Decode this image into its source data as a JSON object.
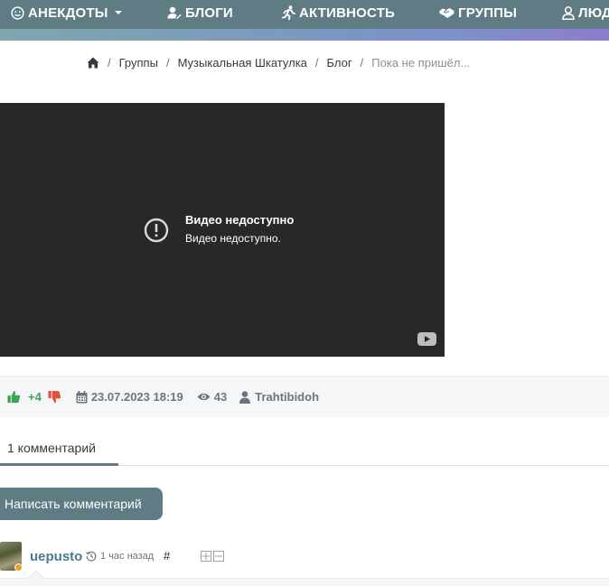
{
  "nav": {
    "items": [
      {
        "label": "АНЕКДОТЫ",
        "icon": "smile-icon",
        "has_dropdown": true
      },
      {
        "label": "БЛОГИ",
        "icon": "user-edit-icon"
      },
      {
        "label": "АКТИВНОСТЬ",
        "icon": "running-icon"
      },
      {
        "label": "ГРУППЫ",
        "icon": "handshake-icon"
      },
      {
        "label": "ЛЮД",
        "icon": "user-icon"
      }
    ]
  },
  "breadcrumb": {
    "home_icon": "home-icon",
    "items": [
      "Группы",
      "Музыкальная Шкатулка",
      "Блог"
    ],
    "current": "Пока не пришёл..."
  },
  "video": {
    "title": "Видео недоступно",
    "subtitle": "Видео недоступно."
  },
  "meta": {
    "rating": "+4",
    "date": "23.07.2023 18:19",
    "views": "43",
    "author": "Trahtibidoh",
    "colors": {
      "like": "#3aa655",
      "dislike": "#e0533d"
    }
  },
  "tabs": {
    "comments_label": "1 комментарий"
  },
  "write_comment_label": "Написать комментарий",
  "comment": {
    "author": "uepusto",
    "time": "1 час назад",
    "hash": "#"
  },
  "colors": {
    "accent": "#5f7b83",
    "link": "#4a7a93"
  }
}
